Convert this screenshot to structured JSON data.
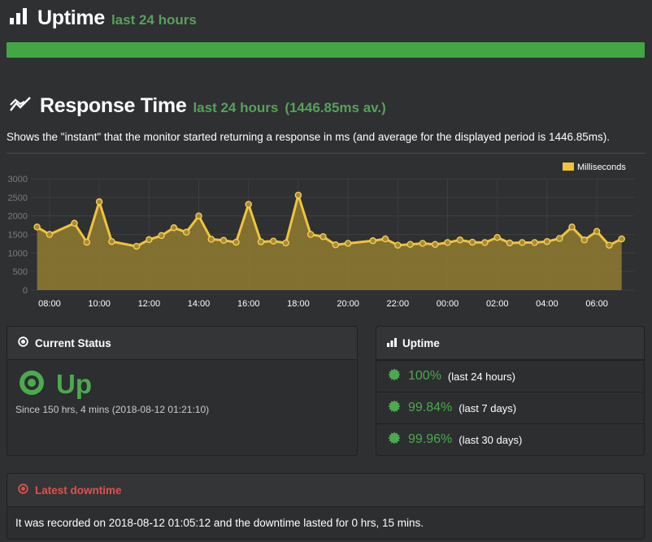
{
  "uptime_header": {
    "title": "Uptime",
    "period": "last 24 hours",
    "icon": "bar-chart-icon",
    "bar_fraction": 1.0,
    "bar_color": "#42a645"
  },
  "response_header": {
    "title": "Response Time",
    "period": "last 24 hours",
    "average": "(1446.85ms av.)",
    "icon": "line-chart-icon"
  },
  "description": "Shows the \"instant\" that the monitor started returning a response in ms (and average for the displayed period is 1446.85ms).",
  "chart_data": {
    "type": "area",
    "legend": "Milliseconds",
    "legend_position": "top-right",
    "series_color": "#f0c43a",
    "grid": true,
    "ylim": [
      0,
      3000
    ],
    "y_ticks": [
      "0",
      "500",
      "1000",
      "1500",
      "2000",
      "2500",
      "3000"
    ],
    "x_ticks": [
      "08:00",
      "10:00",
      "12:00",
      "14:00",
      "16:00",
      "18:00",
      "20:00",
      "22:00",
      "00:00",
      "02:00",
      "04:00",
      "06:00"
    ],
    "x_hours": [
      7.5,
      8.0,
      9.0,
      9.5,
      10.0,
      10.5,
      11.5,
      12.0,
      12.5,
      13.0,
      13.5,
      14.0,
      14.5,
      15.0,
      15.5,
      16.0,
      16.5,
      17.0,
      17.5,
      18.0,
      18.5,
      19.0,
      19.5,
      20.0,
      21.0,
      21.5,
      22.0,
      22.5,
      23.0,
      23.5,
      24.0,
      24.5,
      25.0,
      25.5,
      26.0,
      26.5,
      27.0,
      27.5,
      28.0,
      28.5,
      29.0,
      29.5,
      30.0,
      30.5,
      31.0
    ],
    "values": [
      1700,
      1500,
      1800,
      1290,
      2380,
      1310,
      1180,
      1360,
      1470,
      1680,
      1560,
      2000,
      1370,
      1340,
      1290,
      2310,
      1300,
      1320,
      1270,
      2560,
      1500,
      1440,
      1220,
      1260,
      1330,
      1380,
      1210,
      1230,
      1260,
      1230,
      1280,
      1350,
      1290,
      1280,
      1420,
      1270,
      1280,
      1280,
      1310,
      1390,
      1700,
      1350,
      1580,
      1210,
      1380
    ]
  },
  "current_status": {
    "heading": "Current Status",
    "state": "Up",
    "since": "Since 150 hrs, 4 mins (2018-08-12 01:21:10)",
    "color": "#4caa4e"
  },
  "uptime_panel": {
    "heading": "Uptime",
    "rows": [
      {
        "pct": "100%",
        "period": "(last 24 hours)"
      },
      {
        "pct": "99.84%",
        "period": "(last 7 days)"
      },
      {
        "pct": "99.96%",
        "period": "(last 30 days)"
      }
    ]
  },
  "latest_downtime": {
    "heading": "Latest downtime",
    "text": "It was recorded on 2018-08-12 01:05:12 and the downtime lasted for 0 hrs, 15 mins.",
    "color": "#e0514b"
  }
}
